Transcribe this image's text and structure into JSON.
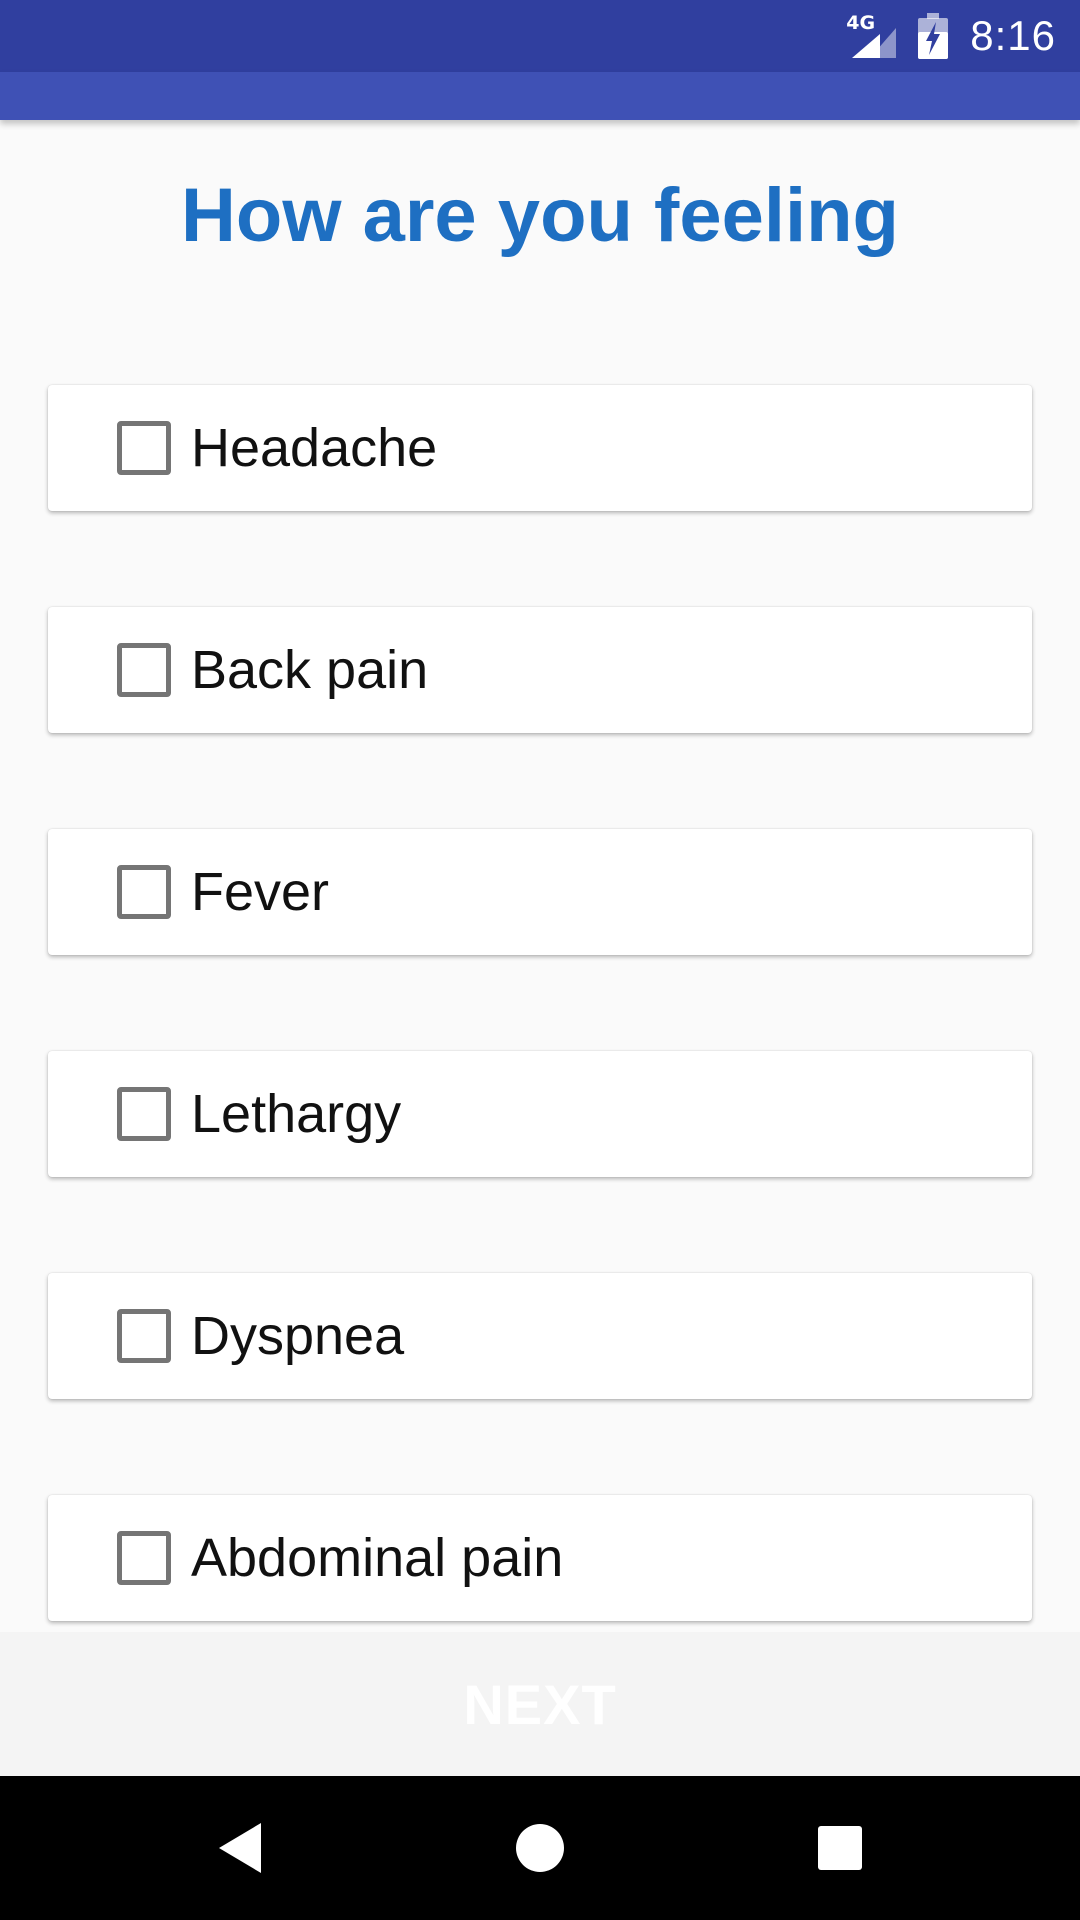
{
  "status_bar": {
    "network_label": "4G",
    "time": "8:16",
    "icons": [
      "signal-icon",
      "battery-charging-icon"
    ]
  },
  "page": {
    "title": "How are you feeling"
  },
  "options": [
    {
      "label": "Headache",
      "checked": false
    },
    {
      "label": "Back pain",
      "checked": false
    },
    {
      "label": "Fever",
      "checked": false
    },
    {
      "label": "Lethargy",
      "checked": false
    },
    {
      "label": "Dyspnea",
      "checked": false
    },
    {
      "label": "Abdominal pain",
      "checked": false
    }
  ],
  "footer": {
    "next_label": "NEXT",
    "next_enabled": false
  },
  "navigation": {
    "icons": [
      "back-icon",
      "home-icon",
      "recents-icon"
    ]
  },
  "colors": {
    "status_bar": "#303f9f",
    "action_bar": "#3f51b5",
    "title_text": "#1e6fc2"
  }
}
